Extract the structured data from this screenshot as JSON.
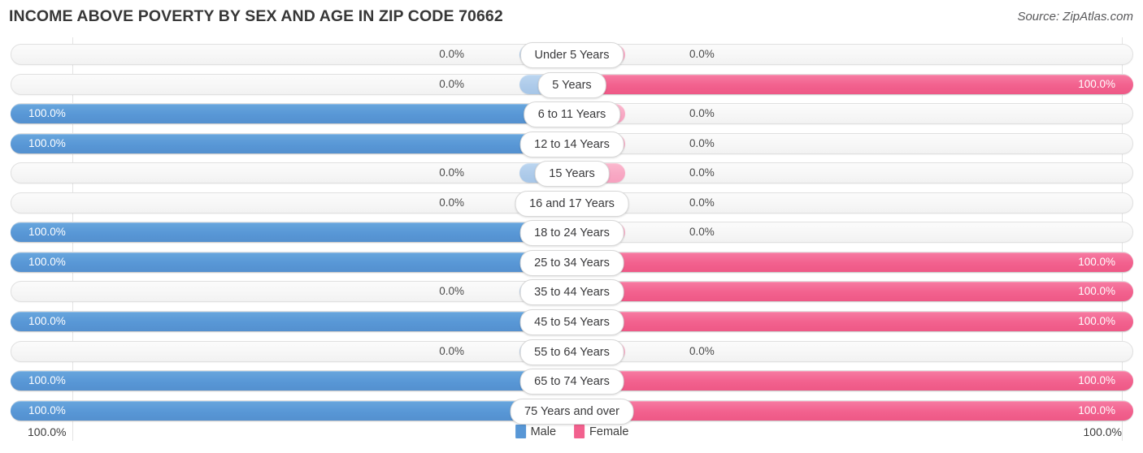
{
  "header": {
    "title": "INCOME ABOVE POVERTY BY SEX AND AGE IN ZIP CODE 70662",
    "source": "Source: ZipAtlas.com"
  },
  "legend": {
    "male_label": "Male",
    "female_label": "Female",
    "male_color": "#5897d6",
    "female_color": "#f2618e"
  },
  "axis": {
    "left_label": "100.0%",
    "right_label": "100.0%",
    "max": 100.0
  },
  "colors": {
    "male": "#5897d6",
    "female": "#f2618e",
    "male_zero": "#aecbea",
    "female_zero": "#f8a8c4",
    "track": "#f6f6f6",
    "title": "#373737"
  },
  "chart_data": {
    "type": "bar",
    "orientation": "horizontal-diverging",
    "title": "INCOME ABOVE POVERTY BY SEX AND AGE IN ZIP CODE 70662",
    "xlabel": "",
    "ylabel": "",
    "xlim": [
      0,
      100
    ],
    "grid": false,
    "legend_position": "bottom-center",
    "categories": [
      "Under 5 Years",
      "5 Years",
      "6 to 11 Years",
      "12 to 14 Years",
      "15 Years",
      "16 and 17 Years",
      "18 to 24 Years",
      "25 to 34 Years",
      "35 to 44 Years",
      "45 to 54 Years",
      "55 to 64 Years",
      "65 to 74 Years",
      "75 Years and over"
    ],
    "series": [
      {
        "name": "Male",
        "values": [
          0.0,
          0.0,
          100.0,
          100.0,
          0.0,
          0.0,
          100.0,
          100.0,
          0.0,
          100.0,
          0.0,
          100.0,
          100.0
        ]
      },
      {
        "name": "Female",
        "values": [
          0.0,
          100.0,
          0.0,
          0.0,
          0.0,
          0.0,
          0.0,
          100.0,
          100.0,
          100.0,
          0.0,
          100.0,
          100.0
        ]
      }
    ]
  },
  "rows": [
    {
      "label": "Under 5 Years",
      "male": "0.0%",
      "female": "0.0%",
      "male_value": 0.0,
      "female_value": 0.0
    },
    {
      "label": "5 Years",
      "male": "0.0%",
      "female": "100.0%",
      "male_value": 0.0,
      "female_value": 100.0
    },
    {
      "label": "6 to 11 Years",
      "male": "100.0%",
      "female": "0.0%",
      "male_value": 100.0,
      "female_value": 0.0
    },
    {
      "label": "12 to 14 Years",
      "male": "100.0%",
      "female": "0.0%",
      "male_value": 100.0,
      "female_value": 0.0
    },
    {
      "label": "15 Years",
      "male": "0.0%",
      "female": "0.0%",
      "male_value": 0.0,
      "female_value": 0.0
    },
    {
      "label": "16 and 17 Years",
      "male": "0.0%",
      "female": "0.0%",
      "male_value": 0.0,
      "female_value": 0.0
    },
    {
      "label": "18 to 24 Years",
      "male": "100.0%",
      "female": "0.0%",
      "male_value": 100.0,
      "female_value": 0.0
    },
    {
      "label": "25 to 34 Years",
      "male": "100.0%",
      "female": "100.0%",
      "male_value": 100.0,
      "female_value": 100.0
    },
    {
      "label": "35 to 44 Years",
      "male": "0.0%",
      "female": "100.0%",
      "male_value": 0.0,
      "female_value": 100.0
    },
    {
      "label": "45 to 54 Years",
      "male": "100.0%",
      "female": "100.0%",
      "male_value": 100.0,
      "female_value": 100.0
    },
    {
      "label": "55 to 64 Years",
      "male": "0.0%",
      "female": "0.0%",
      "male_value": 0.0,
      "female_value": 0.0
    },
    {
      "label": "65 to 74 Years",
      "male": "100.0%",
      "female": "100.0%",
      "male_value": 100.0,
      "female_value": 100.0
    },
    {
      "label": "75 Years and over",
      "male": "100.0%",
      "female": "100.0%",
      "male_value": 100.0,
      "female_value": 100.0
    }
  ]
}
